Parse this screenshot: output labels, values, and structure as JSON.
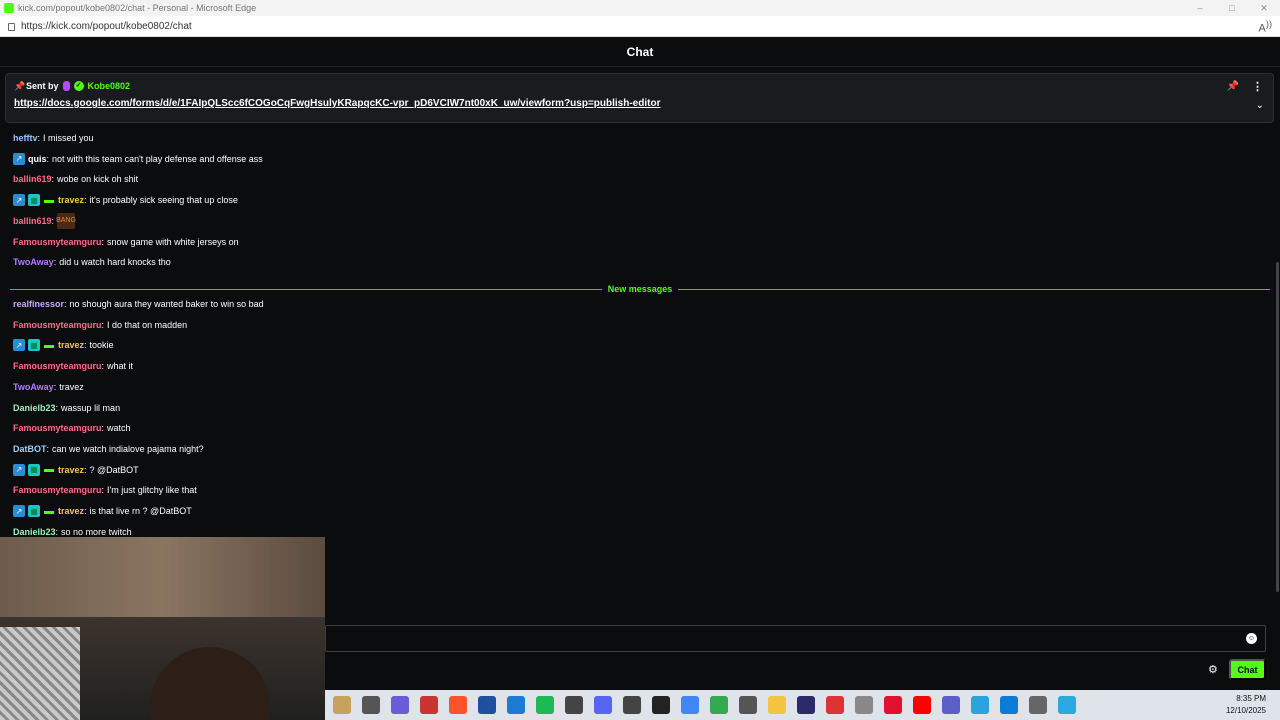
{
  "browser": {
    "window_title": "kick.com/popout/kobe0802/chat - Personal - Microsoft Edge",
    "url": "https://kick.com/popout/kobe0802/chat",
    "window_controls": [
      "–",
      "□",
      "✕"
    ]
  },
  "chat_header": {
    "title": "Chat"
  },
  "pinned": {
    "sent_by_label": "Sent by",
    "sender": "Kobe0802",
    "link": "https://docs.google.com/forms/d/e/1FAIpQLScc6fCOGoCqFwgHsulyKRapqcKC-vpr_pD6VCIW7nt00xK_uw/viewform?usp=publish-editor"
  },
  "messages_before": [
    {
      "user": "hefftv",
      "color": "#9cc3ff",
      "text": "I missed you",
      "badges": []
    },
    {
      "user": "quis",
      "color": "#ffffff",
      "text": "not with this team can't play defense and offense ass",
      "badges": [
        "og"
      ]
    },
    {
      "user": "ballin619",
      "color": "#ff6b8a",
      "text": "wobe on kick oh shit",
      "badges": []
    },
    {
      "user": "travez",
      "color": "#f2c94c",
      "text": "it's probably sick seeing that up close",
      "badges": [
        "og",
        "sub",
        "gift"
      ]
    },
    {
      "user": "ballin619",
      "color": "#ff6b8a",
      "text": "",
      "badges": [],
      "emote": "BANG"
    },
    {
      "user": "Famousmyteamguru",
      "color": "#ff6b8a",
      "text": "snow game with white jerseys on",
      "badges": []
    },
    {
      "user": "TwoAway",
      "color": "#b57cff",
      "text": "did u watch hard knocks tho",
      "badges": []
    }
  ],
  "new_messages_label": "New messages",
  "messages_after": [
    {
      "user": "realfinessor",
      "color": "#c9a7ff",
      "text": "no shough aura they wanted baker to win so bad",
      "badges": []
    },
    {
      "user": "Famousmyteamguru",
      "color": "#ff6b8a",
      "text": "I do that on madden",
      "badges": []
    },
    {
      "user": "travez",
      "color": "#f2c94c",
      "text": "tookie",
      "badges": [
        "og",
        "sub",
        "gift"
      ]
    },
    {
      "user": "Famousmyteamguru",
      "color": "#ff6b8a",
      "text": "what it",
      "badges": []
    },
    {
      "user": "TwoAway",
      "color": "#b57cff",
      "text": "travez",
      "badges": []
    },
    {
      "user": "Danielb23",
      "color": "#9df2b9",
      "text": "wassup lil man",
      "badges": []
    },
    {
      "user": "Famousmyteamguru",
      "color": "#ff6b8a",
      "text": "watch",
      "badges": []
    },
    {
      "user": "DatBOT",
      "color": "#8fd3ff",
      "text": "can we watch indialove pajama night?",
      "badges": []
    },
    {
      "user": "travez",
      "color": "#f2c94c",
      "text": "? @DatBOT",
      "badges": [
        "og",
        "sub",
        "gift"
      ]
    },
    {
      "user": "Famousmyteamguru",
      "color": "#ff6b8a",
      "text": "I'm just glitchy like that",
      "badges": []
    },
    {
      "user": "travez",
      "color": "#f2c94c",
      "text": "is that live rn ? @DatBOT",
      "badges": [
        "og",
        "sub",
        "gift"
      ]
    },
    {
      "user": "Danielb23",
      "color": "#9df2b9",
      "text": "so no more twitch",
      "badges": []
    }
  ],
  "input": {
    "value": "",
    "placeholder": ""
  },
  "send_label": "Chat",
  "taskbar": {
    "icons": [
      "file-explorer-icon",
      "task-view-icon",
      "copilot-icon",
      "voicemeeter-icon",
      "brave-icon",
      "ccleaner-icon",
      "photos-icon",
      "spotify-icon",
      "obs-icon",
      "discord-icon",
      "chatgpt-icon",
      "threads-icon",
      "chrome-icon",
      "chrome-alt-icon",
      "store-icon",
      "folder-icon",
      "media-player-icon",
      "capcut-icon",
      "vpn-icon",
      "opera-icon",
      "youtube-icon",
      "teams-icon",
      "telegram-icon",
      "edge-icon",
      "settings-icon",
      "notepad-icon"
    ],
    "icon_colors": [
      "#c8a25a",
      "#555555",
      "#6b5bd6",
      "#c33",
      "#fb542b",
      "#1f4f9f",
      "#1d7bd6",
      "#1db954",
      "#444",
      "#5865f2",
      "#444",
      "#222",
      "#4285f4",
      "#34a853",
      "#555",
      "#f4c542",
      "#2b2b6b",
      "#d33",
      "#888",
      "#e0102e",
      "#ff0000",
      "#5b5fc7",
      "#2aa3df",
      "#0c7bd8",
      "#666",
      "#2ba8e0"
    ],
    "time": "8:35 PM",
    "date": "12/10/2025"
  }
}
